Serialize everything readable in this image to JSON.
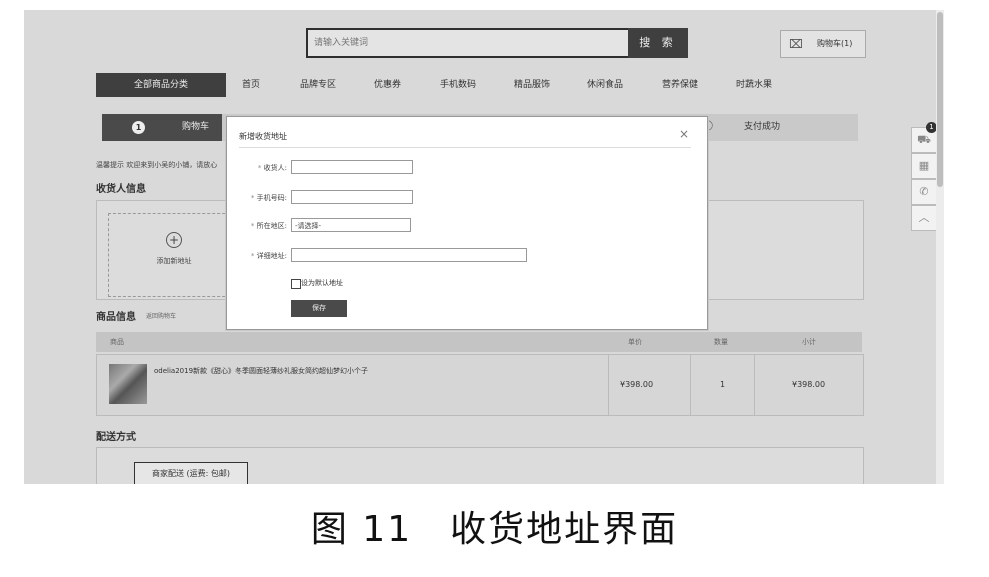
{
  "header": {
    "search_placeholder": "请输入关键词",
    "search_button": "搜 索",
    "cart_label": "购物车(1)"
  },
  "nav": {
    "all_categories": "全部商品分类",
    "items": [
      "首页",
      "品牌专区",
      "优惠券",
      "手机数码",
      "精品服饰",
      "休闲食品",
      "营养保健",
      "时蔬水果"
    ]
  },
  "steps": {
    "step1_number": "1",
    "step1_label": "购物车",
    "last_label": "支付成功"
  },
  "tip": "温馨提示 欢迎来到小吴的小铺，请放心",
  "receiver_section": {
    "title": "收货人信息",
    "add_address": "添加新地址"
  },
  "goods_section": {
    "title": "商品信息",
    "back_link": "返回购物车",
    "columns": [
      "商品",
      "单价",
      "数量",
      "小计"
    ],
    "rows": [
      {
        "name": "odelia2019新款《甜心》冬季圆面轻薄纱礼服女简约超仙梦幻小个子",
        "price": "¥398.00",
        "qty": "1",
        "subtotal": "¥398.00"
      }
    ]
  },
  "shipping_section": {
    "title": "配送方式",
    "option": "商家配送 (运费: 包邮)"
  },
  "side_tools": {
    "cart_badge": "1"
  },
  "modal": {
    "title": "新增收货地址",
    "close": "×",
    "fields": {
      "receiver_label": "收货人:",
      "phone_label": "手机号码:",
      "region_label": "所在地区:",
      "region_value": "-请选择-",
      "detail_label": "详细地址:"
    },
    "required_mark": "*",
    "default_checkbox_label": "设为默认地址",
    "save_button": "保存"
  },
  "caption": "图 11　收货地址界面"
}
